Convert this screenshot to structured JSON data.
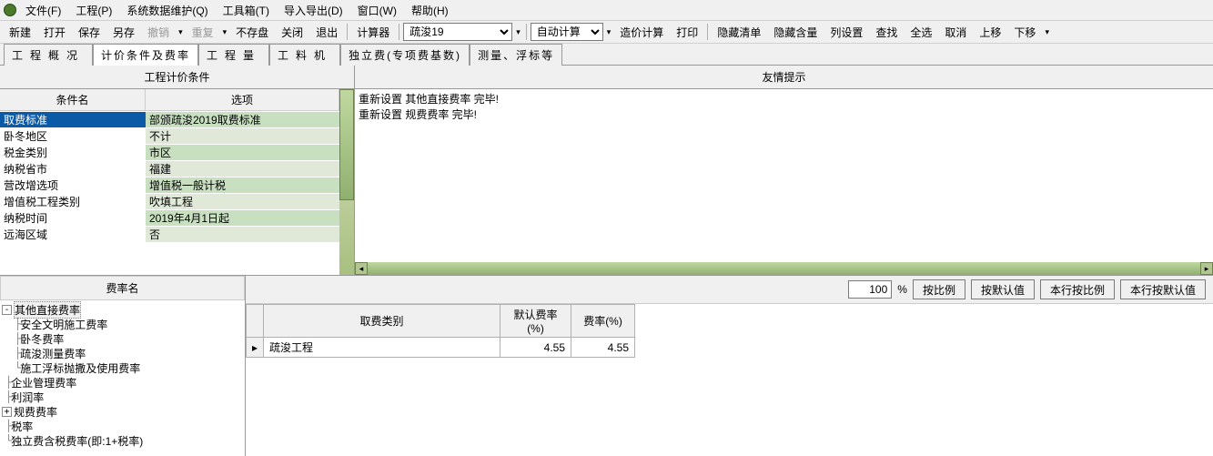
{
  "menu": {
    "file": "文件(F)",
    "project": "工程(P)",
    "sysdata": "系统数据维护(Q)",
    "toolbox": "工具箱(T)",
    "importexport": "导入导出(D)",
    "window": "窗口(W)",
    "help": "帮助(H)"
  },
  "toolbar": {
    "new": "新建",
    "open": "打开",
    "save": "保存",
    "saveas": "另存",
    "undo": "撤销",
    "redo": "重复",
    "nosave": "不存盘",
    "close": "关闭",
    "exit": "退出",
    "calculator": "计算器",
    "project_combo": "疏浚19",
    "calc_combo": "自动计算",
    "costcalc": "造价计算",
    "print": "打印",
    "hidelist": "隐藏清单",
    "hidecontent": "隐藏含量",
    "colset": "列设置",
    "find": "查找",
    "selall": "全选",
    "cancel": "取消",
    "moveup": "上移",
    "movedown": "下移"
  },
  "tabs": {
    "overview": "工程概况",
    "pricing": "计价条件及费率",
    "qty": "工程量",
    "material": "工料机",
    "indep": "独立费(专项费基数)",
    "survey": "测量、浮标等"
  },
  "left_panel": {
    "title": "工程计价条件",
    "header_name": "条件名",
    "header_opt": "选项",
    "rows": [
      {
        "name": "取费标准",
        "opt": "部颁疏浚2019取费标准"
      },
      {
        "name": "卧冬地区",
        "opt": "不计"
      },
      {
        "name": "税金类别",
        "opt": "市区"
      },
      {
        "name": "纳税省市",
        "opt": "福建"
      },
      {
        "name": "营改增选项",
        "opt": "增值税一般计税"
      },
      {
        "name": "增值税工程类别",
        "opt": "吹填工程"
      },
      {
        "name": "纳税时间",
        "opt": "2019年4月1日起"
      },
      {
        "name": "远海区域",
        "opt": "否"
      }
    ]
  },
  "right_panel": {
    "title": "友情提示",
    "log": "重新设置 其他直接费率 完毕!\n重新设置 规费费率 完毕!"
  },
  "tree": {
    "title": "费率名",
    "nodes": {
      "other_direct": "其他直接费率",
      "safe_construct": "安全文明施工费率",
      "winter": "卧冬费率",
      "dredge_survey": "疏浚测量费率",
      "float_marker": "施工浮标抛撒及使用费率",
      "enterprise_mgmt": "企业管理费率",
      "profit": "利润率",
      "regulation_fee": "规费费率",
      "tax": "税率",
      "indep_tax": "独立费含税费率(即:1+税率)"
    }
  },
  "rate_toolbar": {
    "percent_value": "100",
    "percent_sign": "%",
    "by_ratio": "按比例",
    "by_default": "按默认值",
    "row_ratio": "本行按比例",
    "row_default": "本行按默认值"
  },
  "rate_grid": {
    "h_category": "取费类别",
    "h_default": "默认费率(%)",
    "h_rate": "费率(%)",
    "row_indicator": "▸",
    "rows": [
      {
        "category": "疏浚工程",
        "default": "4.55",
        "rate": "4.55"
      }
    ]
  }
}
